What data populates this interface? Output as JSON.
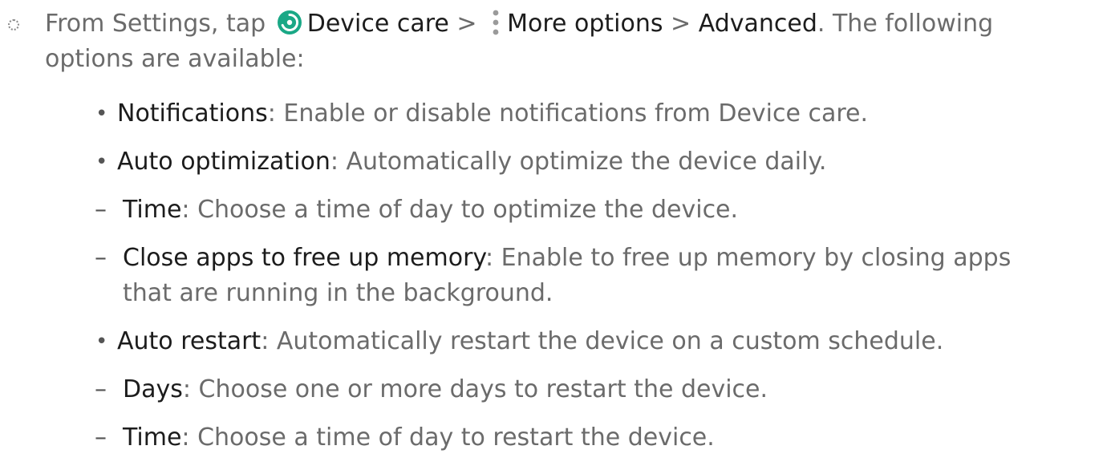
{
  "step": {
    "prefix": "From Settings, tap ",
    "device_care_label": "Device care",
    "sep1": " > ",
    "more_options_label": "More options",
    "sep2": " > ",
    "advanced_label": "Advanced",
    "suffix_line1": ". The following",
    "line2": "options are available:"
  },
  "icons": {
    "device_care": "device-care-icon",
    "more_options": "more-options-icon"
  },
  "options": {
    "notifications": {
      "title": "Notifications",
      "desc": ": Enable or disable notifications from Device care."
    },
    "auto_optimization": {
      "title": "Auto optimization",
      "desc": ": Automatically optimize the device daily.",
      "time": {
        "title": "Time",
        "desc": ": Choose a time of day to optimize the device."
      },
      "close_apps": {
        "title": "Close apps to free up memory",
        "desc_line1": ": Enable to free up memory by closing apps",
        "desc_line2": "that are running in the background."
      }
    },
    "auto_restart": {
      "title": "Auto restart",
      "desc": ": Automatically restart the device on a custom schedule.",
      "days": {
        "title": "Days",
        "desc": ": Choose one or more days to restart the device."
      },
      "time": {
        "title": "Time",
        "desc": ": Choose a time of day to restart the device."
      }
    }
  },
  "colors": {
    "body_text": "#6b6b6b",
    "emphasis_text": "#1c1c1c",
    "device_care_teal": "#1aa886"
  }
}
